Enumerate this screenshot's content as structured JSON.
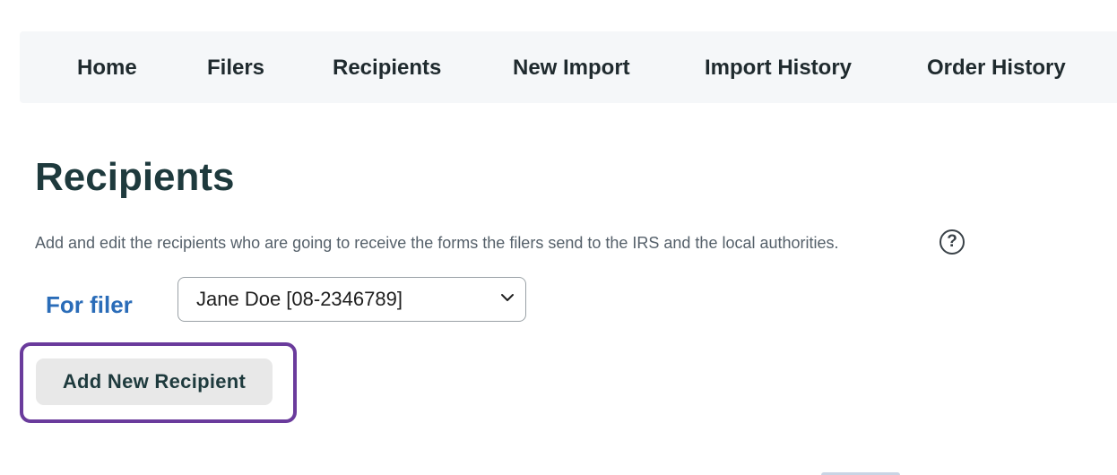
{
  "nav": {
    "items": [
      {
        "label": "Home"
      },
      {
        "label": "Filers"
      },
      {
        "label": "Recipients"
      },
      {
        "label": "New Import"
      },
      {
        "label": "Import History"
      },
      {
        "label": "Order History"
      }
    ]
  },
  "page": {
    "title": "Recipients",
    "description": "Add and edit the recipients who are going to receive the forms the filers send to the IRS and the local authorities.",
    "help_icon": "question-circle-icon"
  },
  "filer": {
    "label": "For filer",
    "selected": "Jane Doe [08-2346789]",
    "dropdown_icon": "chevron-down-icon"
  },
  "actions": {
    "add_recipient_label": "Add New Recipient"
  },
  "colors": {
    "nav_background": "#f5f7f9",
    "title": "#1e3a3d",
    "filer_label": "#2a6cb8",
    "highlight": "#6a3b9c",
    "button_background": "#e8e8e8"
  }
}
